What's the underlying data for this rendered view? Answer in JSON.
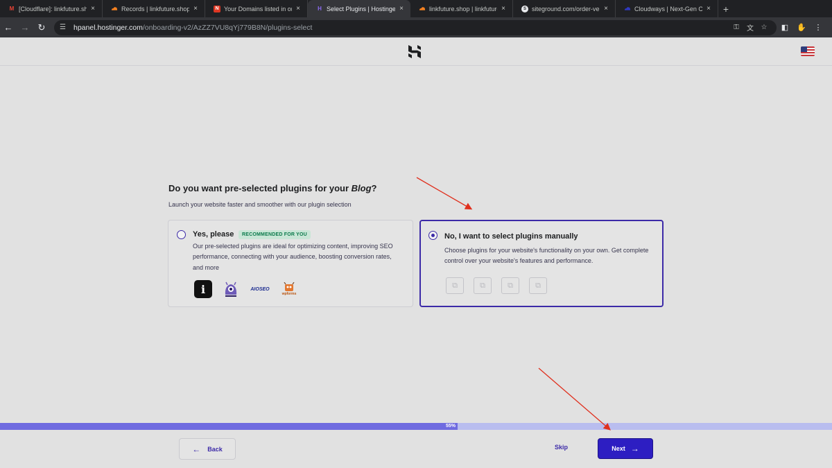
{
  "browser": {
    "tabs": [
      {
        "label": "[Cloudflare]: linkfuture.shop",
        "favicon": "gmail-icon",
        "close": "×"
      },
      {
        "label": "Records | linkfuture.shop | M",
        "favicon": "cloudflare-icon",
        "close": "×"
      },
      {
        "label": "Your Domains listed in one p",
        "favicon": "namecheap-icon",
        "close": "×"
      },
      {
        "label": "Select Plugins | Hostinger",
        "favicon": "hostinger-icon",
        "close": "×",
        "active": true
      },
      {
        "label": "linkfuture.shop | linkfuture.sh",
        "favicon": "cloudflare-icon",
        "close": "×"
      },
      {
        "label": "siteground.com/order-verific",
        "favicon": "siteground-icon",
        "close": "×"
      },
      {
        "label": "Cloudways | Next-Gen Cloud",
        "favicon": "cloudways-icon",
        "close": "×"
      }
    ],
    "new_tab": "+",
    "url_host": "hpanel.hostinger.com",
    "url_path": "/onboarding-v2/AzZZ7VU8qYj779B8N/plugins-select"
  },
  "page": {
    "question_prefix": "Do you want pre-selected plugins for your ",
    "question_emph": "Blog",
    "question_suffix": "?",
    "subtitle": "Launch your website faster and smoother with our plugin selection",
    "option_yes": {
      "title": "Yes, please",
      "badge": "RECOMMENDED FOR YOU",
      "desc_lines": [
        "Our pre-selected plugins are ideal for optimizing content, improving SEO",
        "performance, connecting with your audience, boosting conversion rates,",
        "and more"
      ],
      "plugins": [
        "jetpack-icon",
        "monsterinsights-icon",
        "aioseo-icon",
        "wpforms-icon"
      ],
      "aioseo_text": "AIOSEO",
      "wpforms_text": "wpforms"
    },
    "option_manual": {
      "title": "No, I want to select plugins manually",
      "desc_lines": [
        "Choose plugins for your website's functionality on your own. Get complete",
        "control over your website's features and performance."
      ],
      "placeholders": 4,
      "selected": true
    },
    "progress": {
      "percent": 55,
      "label": "55%"
    },
    "back_label": "Back",
    "skip_label": "Skip",
    "next_label": "Next"
  },
  "colors": {
    "accent": "#3c2aa8",
    "next_button": "#2d1ec2",
    "progress_fill": "#6f6be0",
    "badge_bg": "#c9e6d6",
    "annotation_arrow": "#e0301e"
  }
}
